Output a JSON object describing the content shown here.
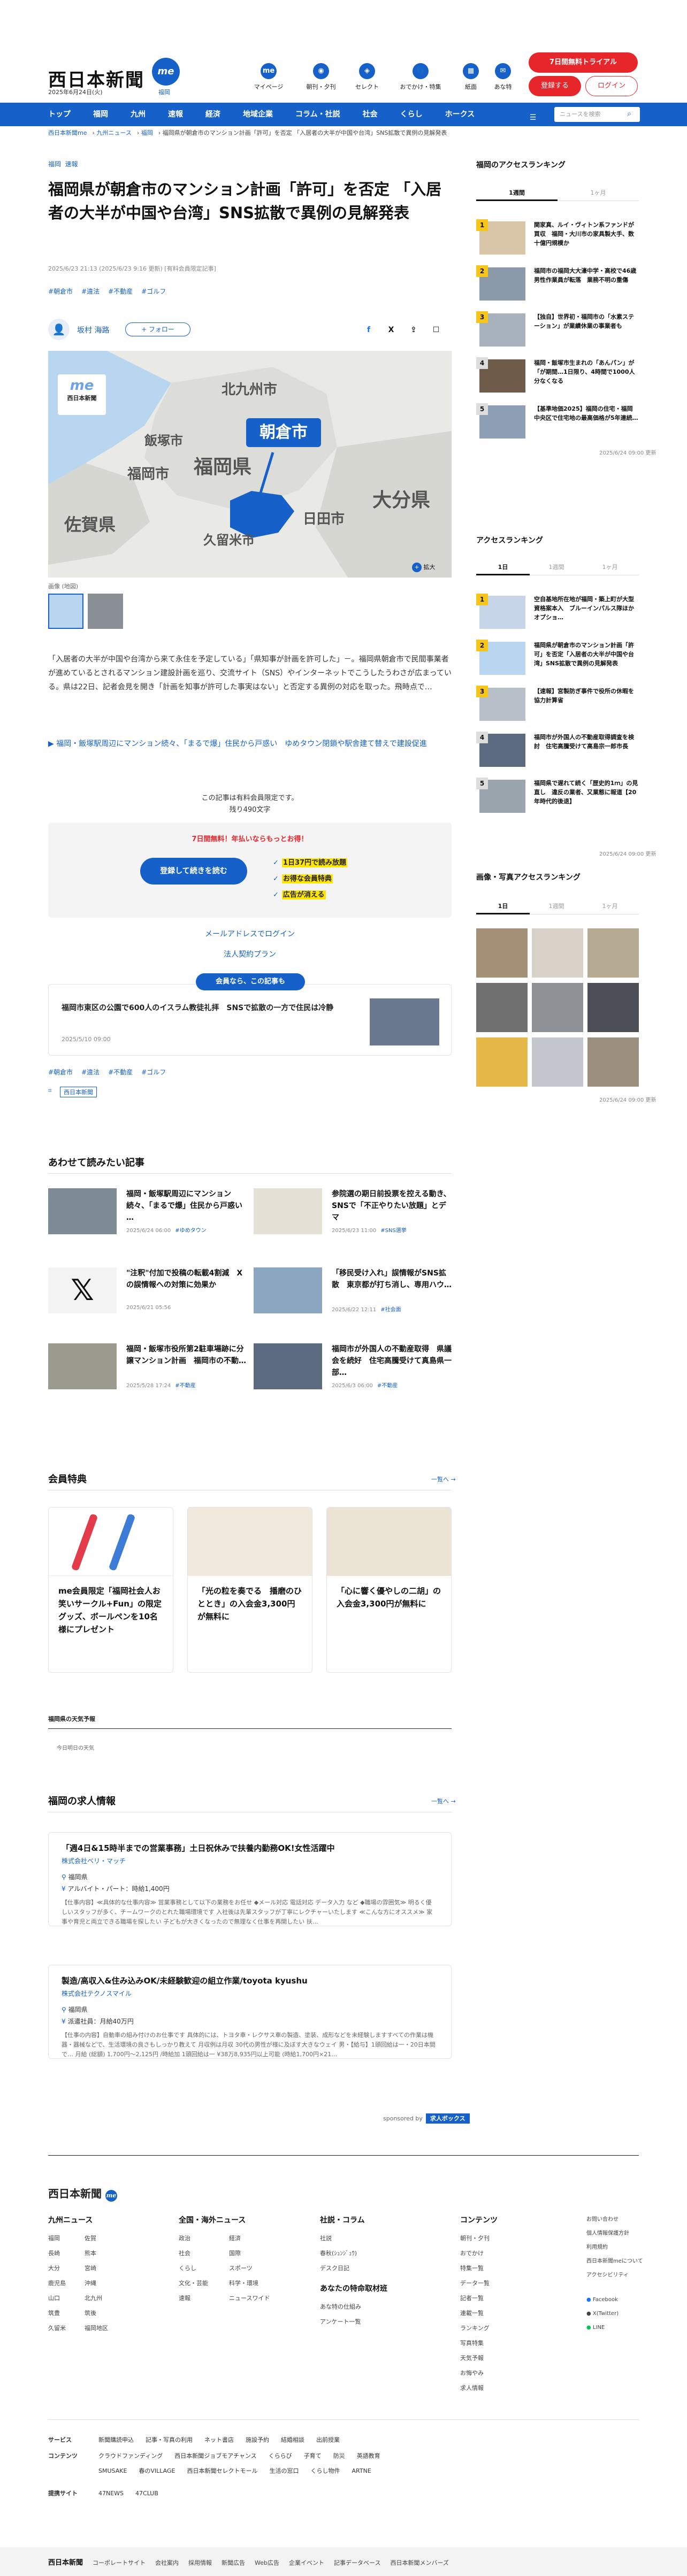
{
  "header": {
    "logo": "西日本新聞",
    "logo_badge": "me",
    "date": "2025年6月24日(火)",
    "area": "福岡",
    "nav": [
      {
        "label": "マイページ",
        "icon": "me"
      },
      {
        "label": "朝刊・夕刊",
        "icon": "◉"
      },
      {
        "label": "セレクト",
        "icon": "◈"
      },
      {
        "label": "おでかけ・特集",
        "icon": "👣"
      },
      {
        "label": "紙面",
        "icon": "▦"
      },
      {
        "label": "あな特",
        "icon": "✉"
      }
    ],
    "trial_label": "7日間無料トライアル",
    "register_label": "登録する",
    "login_label": "ログイン"
  },
  "navbar": {
    "items": [
      "トップ",
      "福岡",
      "九州",
      "速報",
      "経済",
      "地域企業",
      "コラム・社説",
      "社会",
      "くらし",
      "ホークス"
    ],
    "search_placeholder": "ニュースを検索",
    "member_label": "会員メニュー"
  },
  "breadcrumb": [
    "西日本新聞me",
    "九州ニュース",
    "福岡",
    "福岡県が朝倉市のマンション計画「許可」を否定 「入居者の大半が中国や台湾」SNS拡散で異例の見解発表"
  ],
  "article": {
    "categories": [
      "福岡",
      "速報"
    ],
    "title": "福岡県が朝倉市のマンション計画「許可」を否定 「入居者の大半が中国や台湾」SNS拡散で異例の見解発表",
    "meta": "2025/6/23 21:13 (2025/6/23 9:16 更新) [有料会員限定記事]",
    "hashtags": [
      "#朝倉市",
      "#違法",
      "#不動産",
      "#ゴルフ"
    ],
    "author": "坂村 海路",
    "follow_label": "+ フォロー",
    "share_icons": [
      "f",
      "X",
      "⇪",
      "☐"
    ],
    "map": {
      "brand": "西日本新聞",
      "labels": [
        "北九州市",
        "飯塚市",
        "朝倉市",
        "福岡市",
        "福岡県",
        "佐賀県",
        "日田市",
        "久留米市",
        "大分県"
      ],
      "zoom_label": "拡大"
    },
    "caption": "画像 (地図)",
    "body": "「入居者の大半が中国や台湾から来て永住を予定している」「県知事が計画を許可した」－。福岡県朝倉市で民間事業者が進めているとされるマンション建設計画を巡り、交流サイト（SNS）やインターネットでこうしたうわさが広まっている。県は22日、記者会見を開き「計画を知事が許可した事実はない」と否定する異例の対応を取った。飛時点で…",
    "related_link": "福岡・飯塚駅周辺にマンション続々、「まるで爆」住民から戸惑い　ゆめタウン閉鎖や駅舎建て替えで建設促進",
    "paywall_text": "この記事は有料会員限定です。",
    "remaining": "残り490文字",
    "trial_head": "7日間無料！年払いならもっとお得！",
    "cta_label": "登録して続きを読む",
    "benefits": [
      "1日37円で読み放題",
      "お得な会員特典",
      "広告が消える"
    ],
    "login_link": "メールアドレスでログイン",
    "corp_link": "法人契約プラン",
    "member_pill": "会員なら、この記事も",
    "member_article": "福岡市東区の公園で600人のイスラム教徒礼拝　SNSで拡散の一方で住民は冷静",
    "member_article_date": "2025/5/10 09:00",
    "bottom_tag": "西日本新聞"
  },
  "recommended": {
    "title": "あわせて読みたい記事",
    "items": [
      {
        "title": "福岡・飯塚駅周辺にマンション続々、「まるで爆」住民から戸惑い …",
        "date": "2025/6/24 06:00",
        "tag": "#ゆめタウン"
      },
      {
        "title": "参院選の期日前投票を控える動き、SNSで「不正やりたい放題」とデマ",
        "date": "2025/6/23 11:00",
        "tag": "#SNS選挙"
      },
      {
        "title": "\"注釈\"付加で投稿の転載4割減　X の誤情報への対策に効果か",
        "date": "2025/6/21 05:56",
        "tag": ""
      },
      {
        "title": "「移民受け入れ」誤情報がSNS拡散　東京都が打ち消し、専用ハウ…",
        "date": "2025/6/22 12:11",
        "tag": "#社会面"
      },
      {
        "title": "福岡・飯塚市役所第2駐車場跡に分譲マンション計画　福岡市の不動…",
        "date": "2025/5/28 17:24",
        "tag": "#不動産"
      },
      {
        "title": "福岡市が外国人の不動産取得　県議会を続好　住宅高騰受けて真島県一部…",
        "date": "2025/6/3 06:00",
        "tag": "#不動産"
      }
    ]
  },
  "perks": {
    "title": "会員特典",
    "more": "一覧へ",
    "items": [
      {
        "title": "me会員限定「福岡社会人お笑いサークル+Fun」の限定グッズ、ボールペンを10名様にプレゼント"
      },
      {
        "title": "「光の粒を奏でる　播磨のひととき」の入会金3,300円が無料に"
      },
      {
        "title": "「心に響く優やしの二胡」の入会金3,300円が無料に"
      }
    ]
  },
  "weather": {
    "title": "福岡県の天気予報",
    "subtitle": "今日明日の天気"
  },
  "jobs": {
    "title": "福岡の求人情報",
    "more": "一覧へ",
    "items": [
      {
        "title": "「週4日&15時半までの営業事務」土日祝休みで扶養内勤務OK!女性活躍中",
        "company": "株式会社ベリ・マッチ",
        "place": "福岡県",
        "pay": "アルバイト・パート：時給1,400円",
        "desc": "【仕事内容】≪具体的な仕事内容≫ 営業事務として以下の業務をお任せ ◆メール対応 電話対応 データ入力 など ◆職場の雰囲気≫ 明るく優しいスタッフが多く、チームワークのとれた職場環境です 入社後は先輩スタッフが丁寧にレクチャーいたします ≪こんな方にオススメ≫ 家事や育児と両立できる職場を探したい 子どもが大きくなったので無理なく仕事を再開したい 扶…"
      },
      {
        "title": "製造/高収入&住み込みOK/未経験歓迎の組立作業/toyota kyushu",
        "company": "株式会社テクノスマイル",
        "place": "福岡県",
        "pay": "派遣社員：月給40万円",
        "desc": "【仕事の内容】自動車の組み付けのお仕事です 具体的には、トヨタ車・レクサス車の製造、塗装、成形などを未経験しますすべての作業は機器・器械などで、生活環境の良さもしっかり教えて 月収例は月収 30代の男性が様に及ぼす大きなウェイ 男・【給与】1頭回給は一・20日本間で… 月給 (総額) 1,700円～2,125円 /時給加 1頭回給は一 ¥38万8,935円以上可能 (時給1,700円×21…"
      }
    ],
    "sponsor_prefix": "sponsored by",
    "sponsor": "求人ボックス"
  },
  "sidebar": {
    "access_title": "福岡のアクセスランキング",
    "tabs1": [
      "1週間",
      "1ヶ月"
    ],
    "rank1": [
      "関家真、ルイ・ヴィトン系ファンドが買収　福岡・大川市の家具製大手、数十億円規模か",
      "福岡市の福岡大大濠中学・高校で46歳男性作業員が転落　業務不明の重傷",
      "【独自】世界初・福岡市の「水素ステーション」が業績休業の事業者も",
      "福岡・飯塚市生まれの「あんパン」が「が期間…1日限り、4時間で1000人分なくなる",
      "【基準地価2025】福岡の住宅・福岡 中央区で住宅地の最高価格が5年連続…"
    ],
    "stamp1": "2025/6/24 09:00 更新",
    "access2_title": "アクセスランキング",
    "tabs2": [
      "1日",
      "1週間",
      "1ヶ月"
    ],
    "rank2": [
      "空自基地所在地が福岡・築上町が大型資格案本入　ブルーインパルス隊ほかオプショ…",
      "福岡県が朝倉市のマンション計画「許可」を否定「入居者の大半が中国や台湾」SNS拡散で異例の見解発表",
      "【速報】宮製防ぎ事件で役所の休暇を協力計算省",
      "福岡市が外国人の不動産取得調査を検討　住宅高騰受けて高島宗一郎市長",
      "福岡県で遅れて続く「歴史的1ｍ」の見直し　違反の業者、又業態に報道【20年時代的後退】"
    ],
    "stamp2": "2025/6/24 09:00 更新",
    "photo_title": "画像・写真アクセスランキング",
    "tabs3": [
      "1日",
      "1週間",
      "1ヶ月"
    ],
    "stamp3": "2025/6/24 09:00 更新"
  },
  "footer": {
    "logo": "西日本新聞",
    "cols": [
      {
        "title": "九州ニュース",
        "items": [
          "福岡",
          "佐賀",
          "長崎",
          "熊本",
          "大分",
          "宮崎",
          "鹿児島",
          "沖縄",
          "山口",
          "北九州",
          "筑豊",
          "筑後",
          "久留米",
          "福岡地区"
        ]
      },
      {
        "title": "全国・海外ニュース",
        "items": [
          "政治",
          "経済",
          "社会",
          "国際",
          "くらし",
          "スポーツ",
          "文化・芸能",
          "科学・環境",
          "速報",
          "ニュースワイド"
        ]
      },
      {
        "title": "社説・コラム",
        "items": [
          "社説",
          "春秋(ｼｭﾝｼﾞｭｳ)",
          "デスク日記",
          "あなたの特命取材班",
          "あな特の仕組み",
          "アンケート一覧"
        ]
      },
      {
        "title": "コンテンツ",
        "items": [
          "朝刊・夕刊",
          "おでかけ",
          "特集一覧",
          "データ一覧",
          "記者一覧",
          "連載一覧",
          "ランキング",
          "写真特集",
          "天気予報",
          "お悔やみ",
          "求人情報"
        ]
      }
    ],
    "right_links": [
      "お問い合わせ",
      "個人情報保護方針",
      "利用規約",
      "西日本新聞meについて",
      "アクセシビリティ",
      "Facebook",
      "X(Twitter)",
      "LINE"
    ],
    "rows": [
      {
        "label": "サービス",
        "items": [
          "新聞購読申込",
          "記事・写真の利用",
          "ネット書店",
          "施設予約",
          "結婚相談",
          "出前授業"
        ]
      },
      {
        "label": "コンテンツ",
        "items": [
          "クラウドファンディング",
          "西日本新聞ジョブモアチャンス",
          "くららび",
          "子育て",
          "防災",
          "英語教育"
        ]
      },
      {
        "label": "",
        "items": [
          "SMUSAKE",
          "春のVILLAGE",
          "西日本新聞セレクトモール",
          "生活の窓口",
          "くらし物件",
          "ARTNE"
        ]
      },
      {
        "label": "提携サイト",
        "items": [
          "47NEWS",
          "47CLUB"
        ]
      }
    ],
    "bottom": [
      "西日本新聞",
      "コーポレートサイト",
      "会社案内",
      "採用情報",
      "新聞広告",
      "Web広告",
      "企業イベント",
      "記事データベース",
      "西日本新聞メンバーズ"
    ]
  }
}
